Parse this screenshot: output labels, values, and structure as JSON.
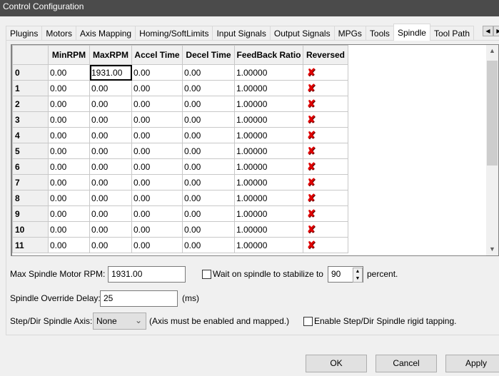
{
  "window": {
    "title": "Control Configuration"
  },
  "tabs": [
    "Plugins",
    "Motors",
    "Axis Mapping",
    "Homing/SoftLimits",
    "Input Signals",
    "Output Signals",
    "MPGs",
    "Tools",
    "Spindle",
    "Tool Path"
  ],
  "active_tab": "Spindle",
  "grid": {
    "columns": [
      "",
      "MinRPM",
      "MaxRPM",
      "Accel Time",
      "Decel Time",
      "FeedBack Ratio",
      "Reversed"
    ],
    "rows": [
      {
        "id": "0",
        "min": "0.00",
        "max": "1931.00",
        "accel": "0.00",
        "decel": "0.00",
        "ratio": "1.00000",
        "reversed": false
      },
      {
        "id": "1",
        "min": "0.00",
        "max": "0.00",
        "accel": "0.00",
        "decel": "0.00",
        "ratio": "1.00000",
        "reversed": false
      },
      {
        "id": "2",
        "min": "0.00",
        "max": "0.00",
        "accel": "0.00",
        "decel": "0.00",
        "ratio": "1.00000",
        "reversed": false
      },
      {
        "id": "3",
        "min": "0.00",
        "max": "0.00",
        "accel": "0.00",
        "decel": "0.00",
        "ratio": "1.00000",
        "reversed": false
      },
      {
        "id": "4",
        "min": "0.00",
        "max": "0.00",
        "accel": "0.00",
        "decel": "0.00",
        "ratio": "1.00000",
        "reversed": false
      },
      {
        "id": "5",
        "min": "0.00",
        "max": "0.00",
        "accel": "0.00",
        "decel": "0.00",
        "ratio": "1.00000",
        "reversed": false
      },
      {
        "id": "6",
        "min": "0.00",
        "max": "0.00",
        "accel": "0.00",
        "decel": "0.00",
        "ratio": "1.00000",
        "reversed": false
      },
      {
        "id": "7",
        "min": "0.00",
        "max": "0.00",
        "accel": "0.00",
        "decel": "0.00",
        "ratio": "1.00000",
        "reversed": false
      },
      {
        "id": "8",
        "min": "0.00",
        "max": "0.00",
        "accel": "0.00",
        "decel": "0.00",
        "ratio": "1.00000",
        "reversed": false
      },
      {
        "id": "9",
        "min": "0.00",
        "max": "0.00",
        "accel": "0.00",
        "decel": "0.00",
        "ratio": "1.00000",
        "reversed": false
      },
      {
        "id": "10",
        "min": "0.00",
        "max": "0.00",
        "accel": "0.00",
        "decel": "0.00",
        "ratio": "1.00000",
        "reversed": false
      },
      {
        "id": "11",
        "min": "0.00",
        "max": "0.00",
        "accel": "0.00",
        "decel": "0.00",
        "ratio": "1.00000",
        "reversed": false
      }
    ],
    "reversed_icon": "red-x-icon"
  },
  "settings": {
    "max_rpm_label": "Max Spindle Motor RPM:",
    "max_rpm_value": "1931.00",
    "wait_label": "Wait on spindle to stabilize to",
    "wait_checked": false,
    "wait_value": "90",
    "wait_suffix": "percent.",
    "override_label": "Spindle Override Delay:",
    "override_value": "25",
    "override_unit": "(ms)",
    "axis_label": "Step/Dir Spindle Axis:",
    "axis_value": "None",
    "axis_note": "(Axis must be enabled and mapped.)",
    "rigid_label": "Enable Step/Dir Spindle rigid tapping.",
    "rigid_checked": false
  },
  "buttons": {
    "ok": "OK",
    "cancel": "Cancel",
    "apply": "Apply"
  }
}
